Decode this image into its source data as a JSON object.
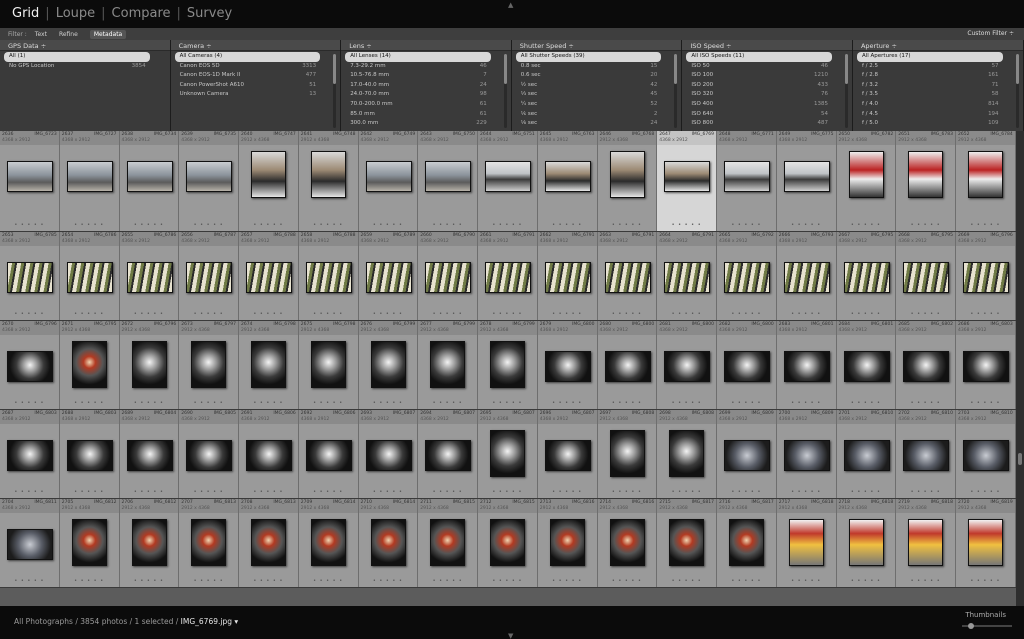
{
  "modules": [
    "Grid",
    "Loupe",
    "Compare",
    "Survey"
  ],
  "filter_bar": {
    "label": "Filter :",
    "tabs": [
      "Text",
      "Refine",
      "Metadata"
    ],
    "custom": "Custom Filter ÷"
  },
  "columns": [
    {
      "title": "GPS Data ÷",
      "rows": [
        {
          "label": "All (1)",
          "count": ""
        },
        {
          "label": "No GPS Location",
          "count": "3854"
        }
      ]
    },
    {
      "title": "Camera ÷",
      "rows": [
        {
          "label": "All Cameras (4)",
          "count": ""
        },
        {
          "label": "Canon EOS 5D",
          "count": "3313"
        },
        {
          "label": "Canon EOS-1D Mark II",
          "count": "477"
        },
        {
          "label": "Canon PowerShot A610",
          "count": "51"
        },
        {
          "label": "Unknown Camera",
          "count": "13"
        }
      ]
    },
    {
      "title": "Lens ÷",
      "rows": [
        {
          "label": "All Lenses (14)",
          "count": ""
        },
        {
          "label": "7.3-29.2 mm",
          "count": "46"
        },
        {
          "label": "10.5-76.8 mm",
          "count": "7"
        },
        {
          "label": "17.0-40.0 mm",
          "count": "24"
        },
        {
          "label": "24.0-70.0 mm",
          "count": "98"
        },
        {
          "label": "70.0-200.0 mm",
          "count": "61"
        },
        {
          "label": "85.0 mm",
          "count": "61"
        },
        {
          "label": "300.0 mm",
          "count": "229"
        }
      ]
    },
    {
      "title": "Shutter Speed ÷",
      "rows": [
        {
          "label": "All Shutter Speeds (39)",
          "count": ""
        },
        {
          "label": "0.8 sec",
          "count": "15"
        },
        {
          "label": "0.6 sec",
          "count": "20"
        },
        {
          "label": "½ sec",
          "count": "42"
        },
        {
          "label": "⅓ sec",
          "count": "45"
        },
        {
          "label": "¼ sec",
          "count": "52"
        },
        {
          "label": "⅙ sec",
          "count": "2"
        },
        {
          "label": "⅛ sec",
          "count": "24"
        }
      ]
    },
    {
      "title": "ISO Speed ÷",
      "rows": [
        {
          "label": "All ISO Speeds (11)",
          "count": ""
        },
        {
          "label": "ISO 50",
          "count": "46"
        },
        {
          "label": "ISO 100",
          "count": "1210"
        },
        {
          "label": "ISO 200",
          "count": "433"
        },
        {
          "label": "ISO 320",
          "count": "76"
        },
        {
          "label": "ISO 400",
          "count": "1385"
        },
        {
          "label": "ISO 640",
          "count": "54"
        },
        {
          "label": "ISO 800",
          "count": "487"
        }
      ]
    },
    {
      "title": "Aperture ÷",
      "rows": [
        {
          "label": "All Apertures (17)",
          "count": ""
        },
        {
          "label": "f / 2.5",
          "count": "57"
        },
        {
          "label": "f / 2.8",
          "count": "161"
        },
        {
          "label": "f / 3.2",
          "count": "71"
        },
        {
          "label": "f / 3.5",
          "count": "58"
        },
        {
          "label": "f / 4.0",
          "count": "814"
        },
        {
          "label": "f / 4.5",
          "count": "194"
        },
        {
          "label": "f / 5.0",
          "count": "109"
        }
      ]
    }
  ],
  "grid_rows": [
    {
      "start": 2636,
      "names": [
        "IMG_6723",
        "IMG_6727",
        "IMG_6734",
        "IMG_6735",
        "IMG_6747",
        "IMG_6748",
        "IMG_6749",
        "IMG_6750",
        "IMG_6751",
        "IMG_6763",
        "IMG_6768",
        "IMG_6769",
        "IMG_6771",
        "IMG_6775",
        "IMG_6782",
        "IMG_6783",
        "IMG_6784"
      ],
      "types": [
        "hangar",
        "hangar",
        "hangar",
        "hangar",
        "crowd",
        "crowd",
        "hangar",
        "hangar",
        "plane",
        "crowd",
        "crowd",
        "crowd",
        "plane",
        "plane",
        "red",
        "red",
        "red"
      ],
      "portrait": [
        false,
        false,
        false,
        false,
        true,
        true,
        false,
        false,
        false,
        false,
        true,
        false,
        false,
        false,
        true,
        true,
        true
      ]
    },
    {
      "start": 2653,
      "names": [
        "IMG_6785",
        "IMG_6786",
        "IMG_6786",
        "IMG_6787",
        "IMG_6788",
        "IMG_6788",
        "IMG_6789",
        "IMG_6790",
        "IMG_6791",
        "IMG_6791",
        "IMG_6791",
        "IMG_6791",
        "IMG_6792",
        "IMG_6793",
        "IMG_6795",
        "IMG_6795",
        "IMG_6796"
      ],
      "types": [
        "fan",
        "fan",
        "fan",
        "fan",
        "fan",
        "fan",
        "fan",
        "fan",
        "fan",
        "fan",
        "fan",
        "fan",
        "fan",
        "fan",
        "fan",
        "fan",
        "fan"
      ],
      "portrait": [
        false,
        false,
        false,
        false,
        false,
        false,
        false,
        false,
        false,
        false,
        false,
        false,
        false,
        false,
        false,
        false,
        false
      ]
    },
    {
      "start": 2670,
      "names": [
        "IMG_6796",
        "IMG_6795",
        "IMG_6796",
        "IMG_6797",
        "IMG_6798",
        "IMG_6798",
        "IMG_6799",
        "IMG_6799",
        "IMG_6799",
        "IMG_6800",
        "IMG_6800",
        "IMG_6800",
        "IMG_6800",
        "IMG_6801",
        "IMG_6801",
        "IMG_6802",
        "IMG_6803"
      ],
      "types": [
        "engine",
        "engine-r",
        "engine",
        "engine",
        "engine",
        "engine",
        "engine",
        "engine",
        "engine",
        "engine",
        "engine",
        "engine",
        "engine",
        "engine",
        "engine",
        "engine",
        "engine"
      ],
      "portrait": [
        false,
        true,
        true,
        true,
        true,
        true,
        true,
        true,
        true,
        false,
        false,
        false,
        false,
        false,
        false,
        false,
        false
      ]
    },
    {
      "start": 2687,
      "names": [
        "IMG_6803",
        "IMG_6803",
        "IMG_6804",
        "IMG_6805",
        "IMG_6806",
        "IMG_6806",
        "IMG_6807",
        "IMG_6807",
        "IMG_6807",
        "IMG_6807",
        "IMG_6808",
        "IMG_6808",
        "IMG_6809",
        "IMG_6809",
        "IMG_6810",
        "IMG_6810",
        "IMG_6810"
      ],
      "types": [
        "engine",
        "engine",
        "engine",
        "engine",
        "engine",
        "engine",
        "engine",
        "engine",
        "engine",
        "engine",
        "engine",
        "engine",
        "grey",
        "grey",
        "grey",
        "grey",
        "grey"
      ],
      "portrait": [
        false,
        false,
        false,
        false,
        false,
        false,
        false,
        false,
        true,
        false,
        true,
        true,
        false,
        false,
        false,
        false,
        false
      ]
    },
    {
      "start": 2704,
      "names": [
        "IMG_6811",
        "IMG_6812",
        "IMG_6812",
        "IMG_6813",
        "IMG_6813",
        "IMG_6814",
        "IMG_6814",
        "IMG_6815",
        "IMG_6815",
        "IMG_6816",
        "IMG_6816",
        "IMG_6817",
        "IMG_6817",
        "IMG_6818",
        "IMG_6818",
        "IMG_6818",
        "IMG_6819"
      ],
      "types": [
        "grey",
        "engine-r",
        "engine-r",
        "engine-r",
        "engine-r",
        "engine-r",
        "engine-r",
        "engine-r",
        "engine-r",
        "engine-r",
        "engine-r",
        "engine-r",
        "engine-r",
        "gear",
        "gear",
        "gear",
        "gear"
      ],
      "portrait": [
        false,
        true,
        true,
        true,
        true,
        true,
        true,
        true,
        true,
        true,
        true,
        true,
        true,
        true,
        true,
        true,
        true
      ]
    }
  ],
  "dims_landscape": "4368 x 2912",
  "dims_portrait": "2912 x 4368",
  "selected_index": 11,
  "status": {
    "prefix": "All Photographs / 3854 photos / 1 selected / ",
    "file": "IMG_6769.jpg ▾"
  },
  "thumbnails_label": "Thumbnails",
  "colors": {
    "panel": "#3a3a3a",
    "grid_cell": "#9a9a9a",
    "selected_cell": "#d6d6d6"
  }
}
